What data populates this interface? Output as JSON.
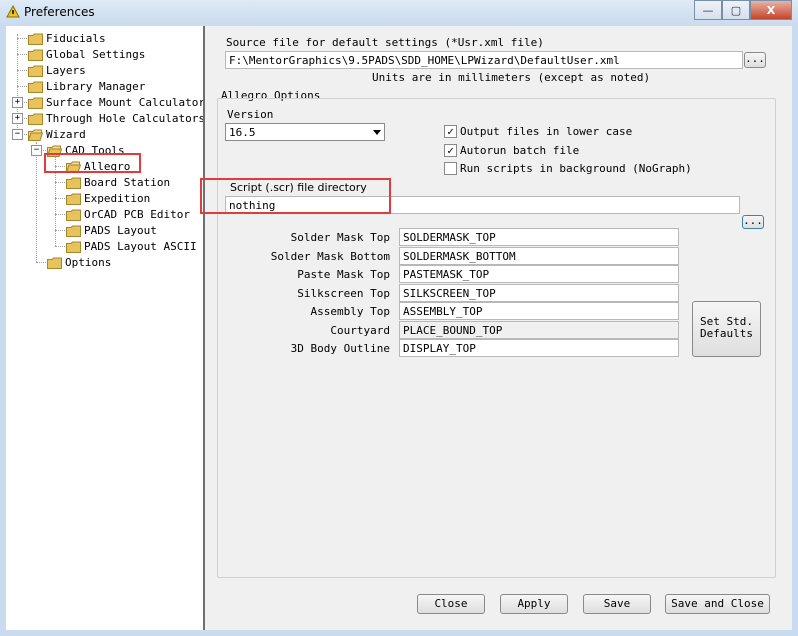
{
  "window": {
    "title": "Preferences",
    "buttons": {
      "minimize": "—",
      "maximize": "▢",
      "close": "X"
    }
  },
  "tree": {
    "items": [
      {
        "label": "Fiducials"
      },
      {
        "label": "Global Settings"
      },
      {
        "label": "Layers"
      },
      {
        "label": "Library Manager"
      },
      {
        "label": "Surface Mount Calculators",
        "expander": "+"
      },
      {
        "label": "Through Hole Calculators",
        "expander": "+"
      },
      {
        "label": "Wizard",
        "expander": "−"
      },
      {
        "label": "CAD Tools",
        "expander": "−"
      },
      {
        "label": "Allegro",
        "selected": true
      },
      {
        "label": "Board Station"
      },
      {
        "label": "Expedition"
      },
      {
        "label": "OrCAD PCB Editor"
      },
      {
        "label": "PADS Layout"
      },
      {
        "label": "PADS Layout ASCII"
      },
      {
        "label": "Options"
      }
    ]
  },
  "source": {
    "label": "Source file for default settings (*Usr.xml file)",
    "value": "F:\\MentorGraphics\\9.5PADS\\SDD_HOME\\LPWizard\\DefaultUser.xml",
    "browse": "...",
    "units_note": "Units are in millimeters (except as noted)"
  },
  "options": {
    "group_title": "Allegro Options",
    "version_label": "Version",
    "version_value": "16.5",
    "checkboxes": [
      {
        "label": "Output files in lower case",
        "checked": true
      },
      {
        "label": "Autorun batch file",
        "checked": true
      },
      {
        "label": "Run scripts in background (NoGraph)",
        "checked": false
      }
    ],
    "script_label": "Script (.scr) file directory",
    "script_value": "nothing",
    "script_browse": "...",
    "layers": [
      {
        "label": "Solder Mask Top",
        "value": "SOLDERMASK_TOP"
      },
      {
        "label": "Solder Mask Bottom",
        "value": "SOLDERMASK_BOTTOM"
      },
      {
        "label": "Paste Mask Top",
        "value": "PASTEMASK_TOP"
      },
      {
        "label": "Silkscreen Top",
        "value": "SILKSCREEN_TOP"
      },
      {
        "label": "Assembly Top",
        "value": "ASSEMBLY_TOP"
      },
      {
        "label": "Courtyard",
        "value": "PLACE_BOUND_TOP"
      },
      {
        "label": "3D Body Outline",
        "value": "DISPLAY_TOP"
      }
    ],
    "std_defaults_line1": "Set Std.",
    "std_defaults_line2": "Defaults"
  },
  "footer": {
    "close": "Close",
    "apply": "Apply",
    "save": "Save",
    "save_close": "Save and Close"
  },
  "colors": {
    "highlight": "#e23b3b",
    "folder": "#e8c25a"
  }
}
